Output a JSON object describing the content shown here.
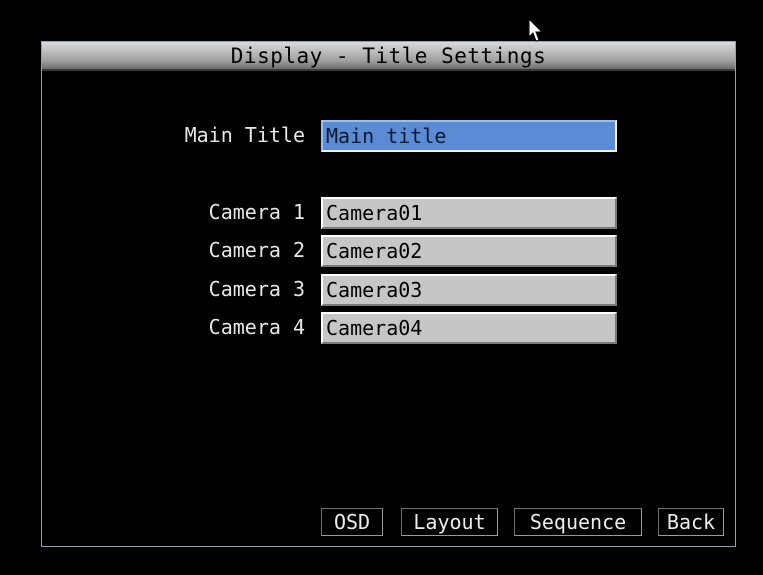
{
  "title": "Display - Title Settings",
  "main_title": {
    "label": "Main Title",
    "value": "Main title"
  },
  "cameras": [
    {
      "label": "Camera 1",
      "value": "Camera01"
    },
    {
      "label": "Camera 2",
      "value": "Camera02"
    },
    {
      "label": "Camera 3",
      "value": "Camera03"
    },
    {
      "label": "Camera 4",
      "value": "Camera04"
    }
  ],
  "buttons": {
    "osd": "OSD",
    "layout": "Layout",
    "sequence": "Sequence",
    "back": "Back"
  },
  "colors": {
    "active_field": "#5a8bd4",
    "field": "#c6c6c6",
    "background": "#000000",
    "text": "#e6e6e6"
  },
  "icons": {
    "pointer": "mouse-pointer-icon"
  }
}
